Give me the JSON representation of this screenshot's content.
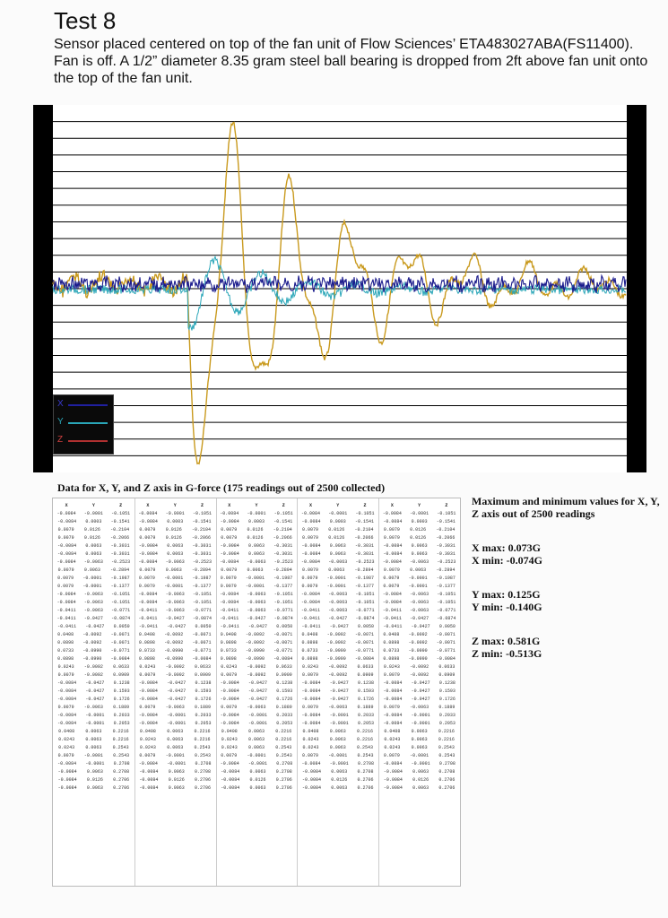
{
  "title": "Test 8",
  "description": "Sensor placed centered on top of the fan unit of Flow Sciences’ ETA483027ABA(FS11400). Fan is off. A 1/2” diameter 8.35 gram steel ball bearing is dropped from 2ft above fan unit onto the top of the fan unit.",
  "colors": {
    "x": "#1a1a8c",
    "y": "#2aa6b8",
    "z": "#c99a1e",
    "background": "#000000",
    "plot": "#ffffff",
    "grid": "#000000"
  },
  "chart_data": {
    "type": "line",
    "series": [
      {
        "name": "X",
        "color": "#1a1a8c"
      },
      {
        "name": "Y",
        "color": "#2aa6b8"
      },
      {
        "name": "Z",
        "color": "#c99a1e"
      }
    ],
    "grid": "horizontal"
  },
  "data_caption": "Data for X, Y, and Z axis in G-force (175 readings out of 2500 collected)",
  "table": {
    "headers": [
      "X",
      "Y",
      "Z"
    ],
    "rows": [
      [
        "-0.0084",
        "-0.0001",
        "-0.1051"
      ],
      [
        "-0.0084",
        "0.0003",
        "-0.1541"
      ],
      [
        "0.0079",
        "0.0126",
        "-0.2104"
      ],
      [
        "0.0079",
        "0.0126",
        "-0.2066"
      ],
      [
        "-0.0084",
        "0.0063",
        "-0.3031"
      ],
      [
        "-0.0084",
        "0.0063",
        "-0.3031"
      ],
      [
        "-0.0084",
        "-0.0063",
        "-0.2523"
      ],
      [
        "0.0079",
        "0.0063",
        "-0.2894"
      ],
      [
        "0.0079",
        "-0.0001",
        "-0.1987"
      ],
      [
        "0.0079",
        "-0.0001",
        "-0.1377"
      ],
      [
        "-0.0084",
        "-0.0063",
        "-0.1051"
      ],
      [
        "-0.0084",
        "-0.0063",
        "-0.1051"
      ],
      [
        "-0.0411",
        "-0.0063",
        "-0.0771"
      ],
      [
        "-0.0411",
        "-0.0427",
        "-0.0874"
      ],
      [
        "-0.0411",
        "-0.0427",
        "0.0050"
      ],
      [
        "0.0408",
        "-0.0092",
        "-0.0071"
      ],
      [
        "0.0898",
        "-0.0092",
        "-0.0071"
      ],
      [
        "0.0733",
        "-0.0990",
        "-0.0771"
      ],
      [
        "0.0898",
        "-0.0990",
        "-0.0084"
      ],
      [
        "0.0243",
        "-0.0092",
        "0.0633"
      ],
      [
        "0.0079",
        "-0.0092",
        "0.0909"
      ],
      [
        "-0.0084",
        "-0.0427",
        "0.1238"
      ],
      [
        "-0.0084",
        "-0.0427",
        "0.1593"
      ],
      [
        "-0.0084",
        "-0.0427",
        "0.1726"
      ],
      [
        "0.0079",
        "-0.0063",
        "0.1889"
      ],
      [
        "-0.0084",
        "-0.0001",
        "0.2033"
      ],
      [
        "-0.0084",
        "-0.0001",
        "0.2053"
      ],
      [
        "0.0408",
        "0.0063",
        "0.2216"
      ],
      [
        "0.0243",
        "0.0063",
        "0.2216"
      ],
      [
        "0.0243",
        "0.0063",
        "0.2543"
      ],
      [
        "0.0079",
        "-0.0001",
        "0.2543"
      ],
      [
        "-0.0084",
        "-0.0001",
        "0.2708"
      ],
      [
        "-0.0084",
        "0.0063",
        "0.2708"
      ],
      [
        "-0.0084",
        "0.0126",
        "0.2706"
      ],
      [
        "-0.0084",
        "0.0063",
        "0.2706"
      ]
    ],
    "columns": 5
  },
  "stats": {
    "heading": "Maximum and minimum values for X, Y, Z axis out of 2500 readings",
    "x_max": "X max: 0.073G",
    "x_min": "X min: -0.074G",
    "y_max": "Y max: 0.125G",
    "y_min": "Y min: -0.140G",
    "z_max": "Z max: 0.581G",
    "z_min": "Z min: -0.513G"
  },
  "legend": {
    "x": "X",
    "y": "Y",
    "z": "Z"
  }
}
